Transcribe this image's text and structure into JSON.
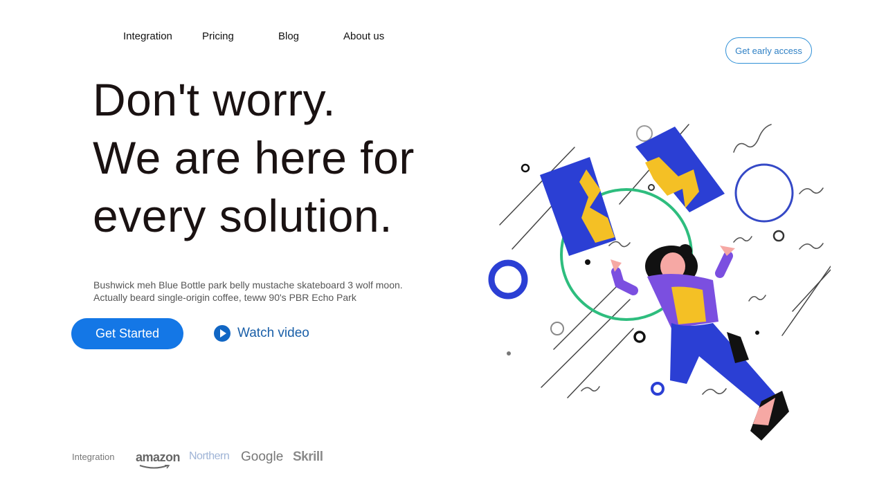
{
  "nav": {
    "items": [
      {
        "label": "Integration"
      },
      {
        "label": "Pricing"
      },
      {
        "label": "Blog"
      },
      {
        "label": "About us"
      }
    ],
    "cta": "Get early access"
  },
  "hero": {
    "headline": [
      "Don't worry.",
      "We are here for",
      "every solution."
    ],
    "description": "Bushwick meh Blue Bottle park belly mustache skateboard 3 wolf moon. Actually beard single-origin coffee, teww 90's PBR Echo Park",
    "primary_button": "Get Started",
    "video_link": "Watch video"
  },
  "brands": {
    "label": "Integration",
    "logos": [
      "amazon",
      "Northern",
      "Google",
      "Skrill"
    ]
  },
  "colors": {
    "accent": "#1477e6",
    "text": "#1a1212",
    "illustration_blue": "#2b3fd4",
    "illustration_yellow": "#f4c025",
    "illustration_green": "#2ebd7e",
    "illustration_purple": "#7b4fe0"
  },
  "icons": {
    "play": "play-icon"
  }
}
